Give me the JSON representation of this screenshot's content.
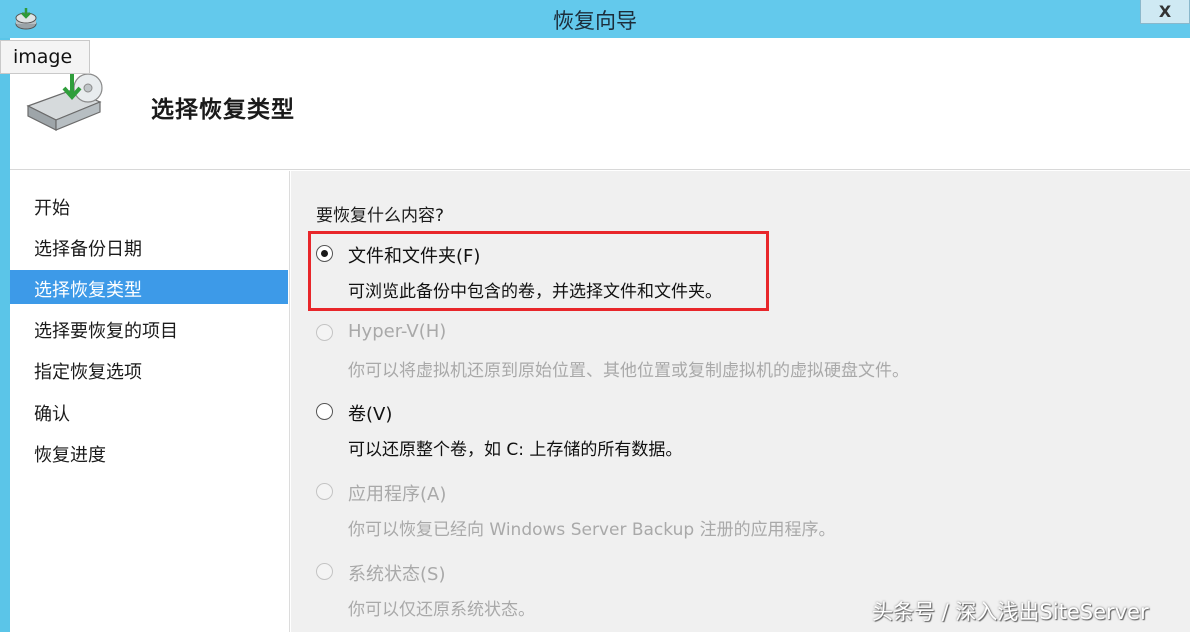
{
  "titlebar": {
    "title": "恢复向导",
    "close_label": "X"
  },
  "tooltip": {
    "text": "image"
  },
  "header": {
    "heading": "选择恢复类型"
  },
  "sidebar": {
    "steps": [
      {
        "label": "开始"
      },
      {
        "label": "选择备份日期"
      },
      {
        "label": "选择恢复类型"
      },
      {
        "label": "选择要恢复的项目"
      },
      {
        "label": "指定恢复选项"
      },
      {
        "label": "确认"
      },
      {
        "label": "恢复进度"
      }
    ],
    "active_step": "选择恢复类型"
  },
  "main": {
    "question": "要恢复什么内容?",
    "options": [
      {
        "label": "文件和文件夹(F)",
        "description": "可浏览此备份中包含的卷，并选择文件和文件夹。",
        "selected": true,
        "enabled": true
      },
      {
        "label": "Hyper-V(H)",
        "description": "你可以将虚拟机还原到原始位置、其他位置或复制虚拟机的虚拟硬盘文件。",
        "selected": false,
        "enabled": false
      },
      {
        "label": "卷(V)",
        "description": "可以还原整个卷，如 C: 上存储的所有数据。",
        "selected": false,
        "enabled": true
      },
      {
        "label": "应用程序(A)",
        "description": "你可以恢复已经向 Windows Server Backup 注册的应用程序。",
        "selected": false,
        "enabled": false
      },
      {
        "label": "系统状态(S)",
        "description": "你可以仅还原系统状态。",
        "selected": false,
        "enabled": false
      }
    ]
  },
  "watermark": {
    "text": "头条号 / 深入浅出SiteServer"
  },
  "colors": {
    "titlebar": "#63c9ec",
    "active_step": "#3d9ae8",
    "highlight": "#e8262a"
  }
}
